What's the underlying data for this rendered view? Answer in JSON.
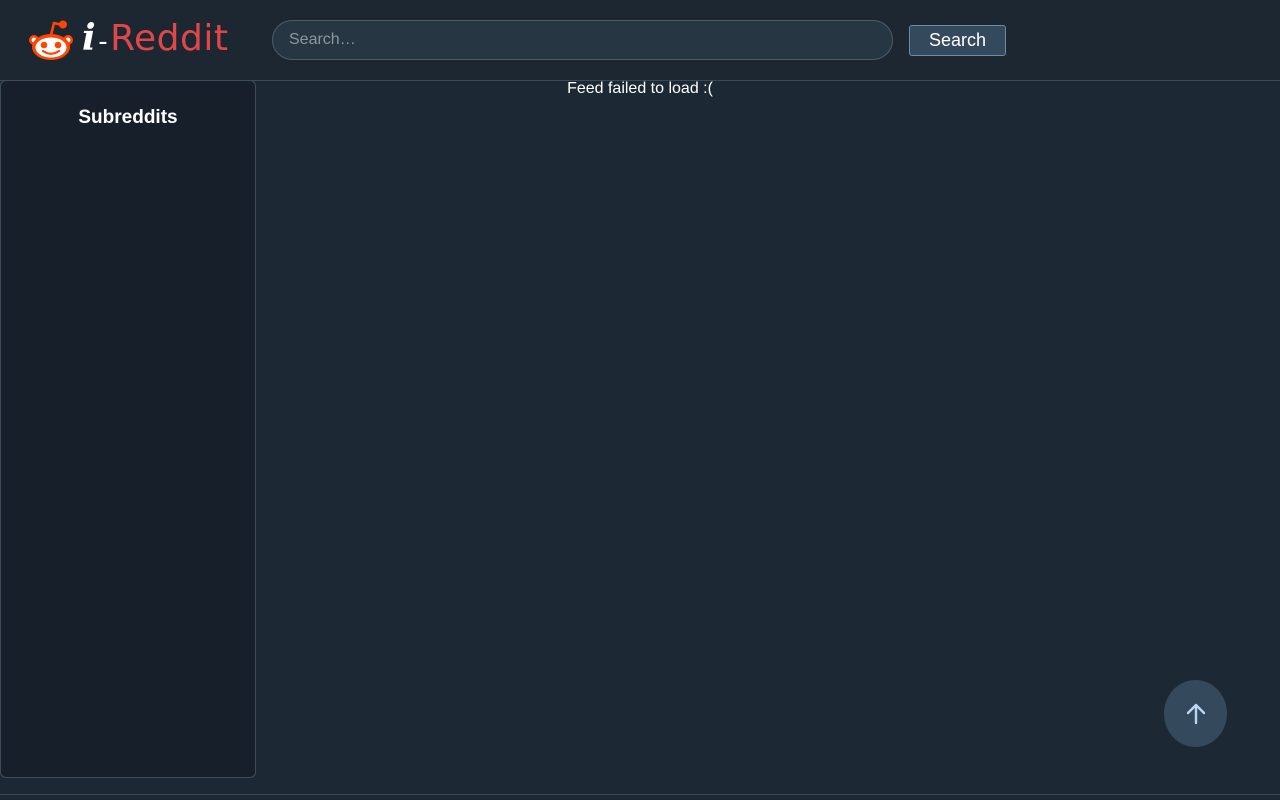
{
  "header": {
    "logo": {
      "prefix": "i",
      "dash": "-",
      "name": "Reddit",
      "icon": "reddit-alien-icon",
      "brand_color": "#ff4500",
      "name_color": "#e0474a"
    },
    "search": {
      "placeholder": "Search…",
      "value": "",
      "button_label": "Search"
    }
  },
  "sidebar": {
    "title": "Subreddits",
    "items": []
  },
  "feed": {
    "status_message": "Feed failed to load :("
  },
  "scroll_to_top": {
    "icon": "arrow-up-icon"
  }
}
